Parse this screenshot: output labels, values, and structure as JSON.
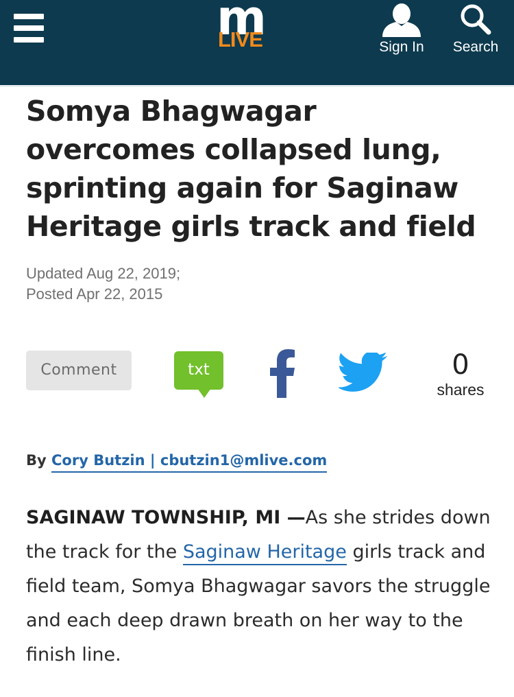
{
  "header": {
    "logo_m": "m",
    "logo_live": "LIVE",
    "sign_in_label": "Sign In",
    "search_label": "Search",
    "colors": {
      "bar": "#0d3a4e",
      "logo_accent": "#f18a1c"
    },
    "icons": [
      "menu-icon",
      "user-icon",
      "search-icon"
    ]
  },
  "article": {
    "headline": "Somya Bhagwagar overcomes collapsed lung, sprinting again for Saginaw Heritage girls track and field",
    "updated": "Updated Aug 22, 2019;",
    "posted": "Posted Apr 22, 2015",
    "share": {
      "comment_label": "Comment",
      "txt_label": "txt",
      "facebook_icon": "facebook-icon",
      "twitter_icon": "twitter-icon",
      "count": "0",
      "count_label": "shares",
      "colors": {
        "txt": "#72c02c",
        "facebook": "#3b5998",
        "twitter": "#1da1f2"
      }
    },
    "byline": {
      "prefix": "By",
      "author": "Cory Butzin | cbutzin1@mlive.com"
    },
    "body": {
      "dateline": "SAGINAW TOWNSHIP, MI —",
      "text_before_link": "As she strides down the track for the",
      "link_text": "Saginaw Heritage",
      "text_after_link": " girls track and field team, Somya Bhagwagar savors the struggle and each deep drawn breath on her way to the finish line."
    }
  }
}
